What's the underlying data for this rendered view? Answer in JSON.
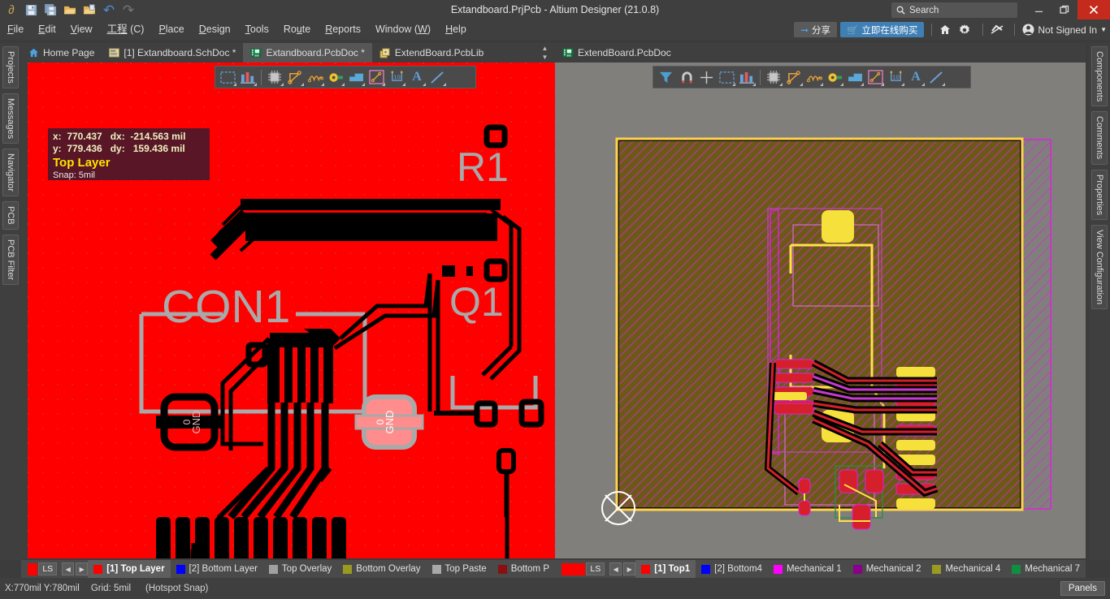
{
  "window": {
    "title": "Extandboard.PrjPcb - Altium Designer (21.0.8)",
    "minimize": "—",
    "maximize": "❐",
    "close": "✕"
  },
  "quick_access": [
    {
      "name": "altium-logo-icon",
      "glyph": "∂",
      "color": "#c8a24a"
    },
    {
      "name": "save-icon",
      "glyph": "▤",
      "color": "#9fb7d4"
    },
    {
      "name": "save-all-icon",
      "glyph": "▥",
      "color": "#9fb7d4"
    },
    {
      "name": "open-icon",
      "glyph": "📂",
      "color": "#e0b457"
    },
    {
      "name": "open-project-icon",
      "glyph": "🗁",
      "color": "#e0b457"
    },
    {
      "name": "undo-icon",
      "glyph": "↶",
      "color": "#5a93d2"
    },
    {
      "name": "redo-icon",
      "glyph": "↷",
      "color": "#7d7d7d"
    }
  ],
  "search": {
    "placeholder": "Search",
    "icon": "search-icon"
  },
  "menu": [
    {
      "label": "File",
      "accel": "F"
    },
    {
      "label": "Edit",
      "accel": "E"
    },
    {
      "label": "View",
      "accel": "V"
    },
    {
      "label": "工程 (C)",
      "accel": "C"
    },
    {
      "label": "Place",
      "accel": "P"
    },
    {
      "label": "Design",
      "accel": "D"
    },
    {
      "label": "Tools",
      "accel": "T"
    },
    {
      "label": "Route",
      "accel": "u"
    },
    {
      "label": "Reports",
      "accel": "R"
    },
    {
      "label": "Window (W)",
      "accel": "W"
    },
    {
      "label": "Help",
      "accel": "H"
    }
  ],
  "menu_right": {
    "share_label": "分享",
    "buy_label": "立即在线购买",
    "home_icon": "home-icon",
    "settings_icon": "gear-icon",
    "notification_icon": "notification-icon",
    "account_label": "Not Signed In",
    "account_icon": "user-icon"
  },
  "doc_tabs_left": [
    {
      "label": "Home Page",
      "icon": "home-icon",
      "active": false,
      "modified": false
    },
    {
      "label": "[1] Extandboard.SchDoc *",
      "icon": "schematic-icon",
      "active": false,
      "modified": true
    },
    {
      "label": "Extandboard.PcbDoc *",
      "icon": "pcb-icon",
      "active": true,
      "modified": true
    },
    {
      "label": "ExtendBoard.PcbLib",
      "icon": "pcblib-icon",
      "active": false,
      "modified": false
    }
  ],
  "doc_tabs_right": [
    {
      "label": "ExtendBoard.PcbDoc",
      "icon": "pcb-icon",
      "active": true,
      "modified": false
    }
  ],
  "left_panel_tabs": [
    "Projects",
    "Messages",
    "Navigator",
    "PCB",
    "PCB Filter"
  ],
  "right_panel_tabs": [
    "Components",
    "Comments",
    "Properties",
    "View Configuration"
  ],
  "toolbar_left": [
    {
      "name": "select-region-icon",
      "glyph": "dashed-rect"
    },
    {
      "name": "bar-chart-icon",
      "glyph": "bars"
    },
    {
      "name": "component-icon",
      "glyph": "chip"
    },
    {
      "name": "route-trace-icon",
      "glyph": "route"
    },
    {
      "name": "differential-pair-icon",
      "glyph": "squiggle"
    },
    {
      "name": "via-icon",
      "glyph": "via"
    },
    {
      "name": "polygon-pour-icon",
      "glyph": "polygon"
    },
    {
      "name": "dimension-icon",
      "glyph": "dimension"
    },
    {
      "name": "coordinate-icon",
      "glyph": "coord"
    },
    {
      "name": "text-string-icon",
      "glyph": "A"
    },
    {
      "name": "line-icon",
      "glyph": "line"
    }
  ],
  "toolbar_right": [
    {
      "name": "filter-icon",
      "glyph": "funnel"
    },
    {
      "name": "magnet-icon",
      "glyph": "magnet"
    },
    {
      "name": "crosshair-icon",
      "glyph": "cross"
    },
    {
      "name": "select-region-icon",
      "glyph": "dashed-rect"
    },
    {
      "name": "bar-chart-icon",
      "glyph": "bars"
    },
    {
      "name": "component-icon",
      "glyph": "chip"
    },
    {
      "name": "route-trace-icon",
      "glyph": "route"
    },
    {
      "name": "differential-pair-icon",
      "glyph": "squiggle"
    },
    {
      "name": "via-icon",
      "glyph": "via"
    },
    {
      "name": "polygon-pour-icon",
      "glyph": "polygon"
    },
    {
      "name": "dimension-icon",
      "glyph": "dimension"
    },
    {
      "name": "coordinate-icon",
      "glyph": "coord"
    },
    {
      "name": "text-string-icon",
      "glyph": "A"
    },
    {
      "name": "line-icon",
      "glyph": "line"
    }
  ],
  "coord_overlay": {
    "x_label": "x:",
    "x_value": "770.437",
    "dx_label": "dx:",
    "dx_value": "-214.563 mil",
    "y_label": "y:",
    "y_value": "779.436",
    "dy_label": "dy:",
    "dy_value": "159.436 mil",
    "line1": "x:  770.437   dx:  -214.563 mil",
    "line2": "y:  779.436   dy:   159.436 mil",
    "layer": "Top Layer",
    "snap": "Snap: 5mil"
  },
  "pcb_left": {
    "background_color": "#FF0000",
    "designators": [
      "CON1",
      "R1",
      "Q1"
    ],
    "pad_labels": [
      "GND",
      "GND"
    ],
    "pad_numbers": [
      "0",
      "0"
    ]
  },
  "pcb_right": {
    "background_color": "#807f7c",
    "board_fill": "#6b5a16",
    "outline_color": "#ffd24a",
    "keepout_color": "#ff00ff",
    "origin_marker": "origin-icon"
  },
  "layers_left": {
    "ls_label": "LS",
    "ls_swatch": "#ff0000",
    "prev": "◀",
    "next": "▶",
    "items": [
      {
        "label": "[1] Top Layer",
        "color": "#ff0000",
        "selected": true
      },
      {
        "label": "[2] Bottom Layer",
        "color": "#0000ff",
        "selected": false
      },
      {
        "label": "Top Overlay",
        "color": "#a0a0a0",
        "selected": false
      },
      {
        "label": "Bottom Overlay",
        "color": "#9a9a21",
        "selected": false
      },
      {
        "label": "Top Paste",
        "color": "#a8a8a8",
        "selected": false
      },
      {
        "label": "Bottom P",
        "color": "#8b0f0f",
        "selected": false
      }
    ]
  },
  "layers_right": {
    "ls_label": "LS",
    "ls_swatch": "#ff0000",
    "prev": "◀",
    "next": "▶",
    "items": [
      {
        "label": "[1] Top1",
        "color": "#ff0000",
        "selected": true
      },
      {
        "label": "[2] Bottom4",
        "color": "#0000ff",
        "selected": false
      },
      {
        "label": "Mechanical 1",
        "color": "#ff00ff",
        "selected": false
      },
      {
        "label": "Mechanical 2",
        "color": "#8b008b",
        "selected": false
      },
      {
        "label": "Mechanical 4",
        "color": "#9a9a21",
        "selected": false
      },
      {
        "label": "Mechanical 7",
        "color": "#0f8f3f",
        "selected": false
      }
    ]
  },
  "status": {
    "coords": "X:770mil Y:780mil",
    "grid": "Grid: 5mil",
    "snap_mode": "(Hotspot Snap)",
    "panels_label": "Panels"
  }
}
